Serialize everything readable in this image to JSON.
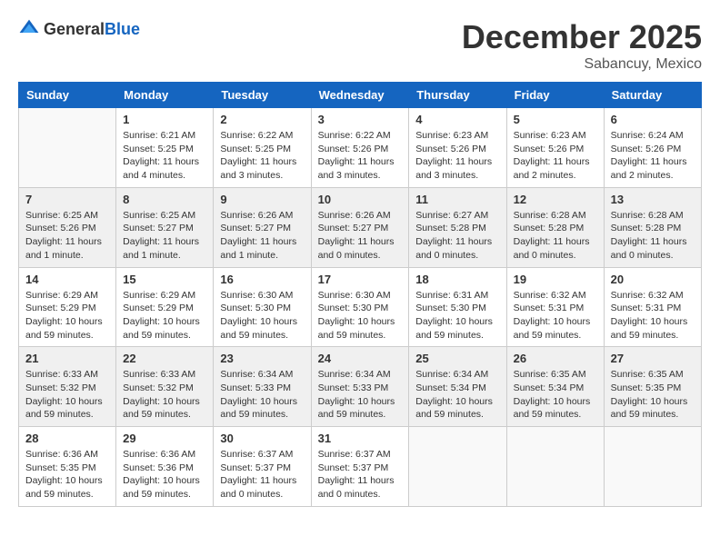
{
  "header": {
    "logo_general": "General",
    "logo_blue": "Blue",
    "month": "December 2025",
    "location": "Sabancuy, Mexico"
  },
  "days_of_week": [
    "Sunday",
    "Monday",
    "Tuesday",
    "Wednesday",
    "Thursday",
    "Friday",
    "Saturday"
  ],
  "weeks": [
    [
      {
        "day": "",
        "info": ""
      },
      {
        "day": "1",
        "info": "Sunrise: 6:21 AM\nSunset: 5:25 PM\nDaylight: 11 hours\nand 4 minutes."
      },
      {
        "day": "2",
        "info": "Sunrise: 6:22 AM\nSunset: 5:25 PM\nDaylight: 11 hours\nand 3 minutes."
      },
      {
        "day": "3",
        "info": "Sunrise: 6:22 AM\nSunset: 5:26 PM\nDaylight: 11 hours\nand 3 minutes."
      },
      {
        "day": "4",
        "info": "Sunrise: 6:23 AM\nSunset: 5:26 PM\nDaylight: 11 hours\nand 3 minutes."
      },
      {
        "day": "5",
        "info": "Sunrise: 6:23 AM\nSunset: 5:26 PM\nDaylight: 11 hours\nand 2 minutes."
      },
      {
        "day": "6",
        "info": "Sunrise: 6:24 AM\nSunset: 5:26 PM\nDaylight: 11 hours\nand 2 minutes."
      }
    ],
    [
      {
        "day": "7",
        "info": "Sunrise: 6:25 AM\nSunset: 5:26 PM\nDaylight: 11 hours\nand 1 minute."
      },
      {
        "day": "8",
        "info": "Sunrise: 6:25 AM\nSunset: 5:27 PM\nDaylight: 11 hours\nand 1 minute."
      },
      {
        "day": "9",
        "info": "Sunrise: 6:26 AM\nSunset: 5:27 PM\nDaylight: 11 hours\nand 1 minute."
      },
      {
        "day": "10",
        "info": "Sunrise: 6:26 AM\nSunset: 5:27 PM\nDaylight: 11 hours\nand 0 minutes."
      },
      {
        "day": "11",
        "info": "Sunrise: 6:27 AM\nSunset: 5:28 PM\nDaylight: 11 hours\nand 0 minutes."
      },
      {
        "day": "12",
        "info": "Sunrise: 6:28 AM\nSunset: 5:28 PM\nDaylight: 11 hours\nand 0 minutes."
      },
      {
        "day": "13",
        "info": "Sunrise: 6:28 AM\nSunset: 5:28 PM\nDaylight: 11 hours\nand 0 minutes."
      }
    ],
    [
      {
        "day": "14",
        "info": "Sunrise: 6:29 AM\nSunset: 5:29 PM\nDaylight: 10 hours\nand 59 minutes."
      },
      {
        "day": "15",
        "info": "Sunrise: 6:29 AM\nSunset: 5:29 PM\nDaylight: 10 hours\nand 59 minutes."
      },
      {
        "day": "16",
        "info": "Sunrise: 6:30 AM\nSunset: 5:30 PM\nDaylight: 10 hours\nand 59 minutes."
      },
      {
        "day": "17",
        "info": "Sunrise: 6:30 AM\nSunset: 5:30 PM\nDaylight: 10 hours\nand 59 minutes."
      },
      {
        "day": "18",
        "info": "Sunrise: 6:31 AM\nSunset: 5:30 PM\nDaylight: 10 hours\nand 59 minutes."
      },
      {
        "day": "19",
        "info": "Sunrise: 6:32 AM\nSunset: 5:31 PM\nDaylight: 10 hours\nand 59 minutes."
      },
      {
        "day": "20",
        "info": "Sunrise: 6:32 AM\nSunset: 5:31 PM\nDaylight: 10 hours\nand 59 minutes."
      }
    ],
    [
      {
        "day": "21",
        "info": "Sunrise: 6:33 AM\nSunset: 5:32 PM\nDaylight: 10 hours\nand 59 minutes."
      },
      {
        "day": "22",
        "info": "Sunrise: 6:33 AM\nSunset: 5:32 PM\nDaylight: 10 hours\nand 59 minutes."
      },
      {
        "day": "23",
        "info": "Sunrise: 6:34 AM\nSunset: 5:33 PM\nDaylight: 10 hours\nand 59 minutes."
      },
      {
        "day": "24",
        "info": "Sunrise: 6:34 AM\nSunset: 5:33 PM\nDaylight: 10 hours\nand 59 minutes."
      },
      {
        "day": "25",
        "info": "Sunrise: 6:34 AM\nSunset: 5:34 PM\nDaylight: 10 hours\nand 59 minutes."
      },
      {
        "day": "26",
        "info": "Sunrise: 6:35 AM\nSunset: 5:34 PM\nDaylight: 10 hours\nand 59 minutes."
      },
      {
        "day": "27",
        "info": "Sunrise: 6:35 AM\nSunset: 5:35 PM\nDaylight: 10 hours\nand 59 minutes."
      }
    ],
    [
      {
        "day": "28",
        "info": "Sunrise: 6:36 AM\nSunset: 5:35 PM\nDaylight: 10 hours\nand 59 minutes."
      },
      {
        "day": "29",
        "info": "Sunrise: 6:36 AM\nSunset: 5:36 PM\nDaylight: 10 hours\nand 59 minutes."
      },
      {
        "day": "30",
        "info": "Sunrise: 6:37 AM\nSunset: 5:37 PM\nDaylight: 11 hours\nand 0 minutes."
      },
      {
        "day": "31",
        "info": "Sunrise: 6:37 AM\nSunset: 5:37 PM\nDaylight: 11 hours\nand 0 minutes."
      },
      {
        "day": "",
        "info": ""
      },
      {
        "day": "",
        "info": ""
      },
      {
        "day": "",
        "info": ""
      }
    ]
  ]
}
